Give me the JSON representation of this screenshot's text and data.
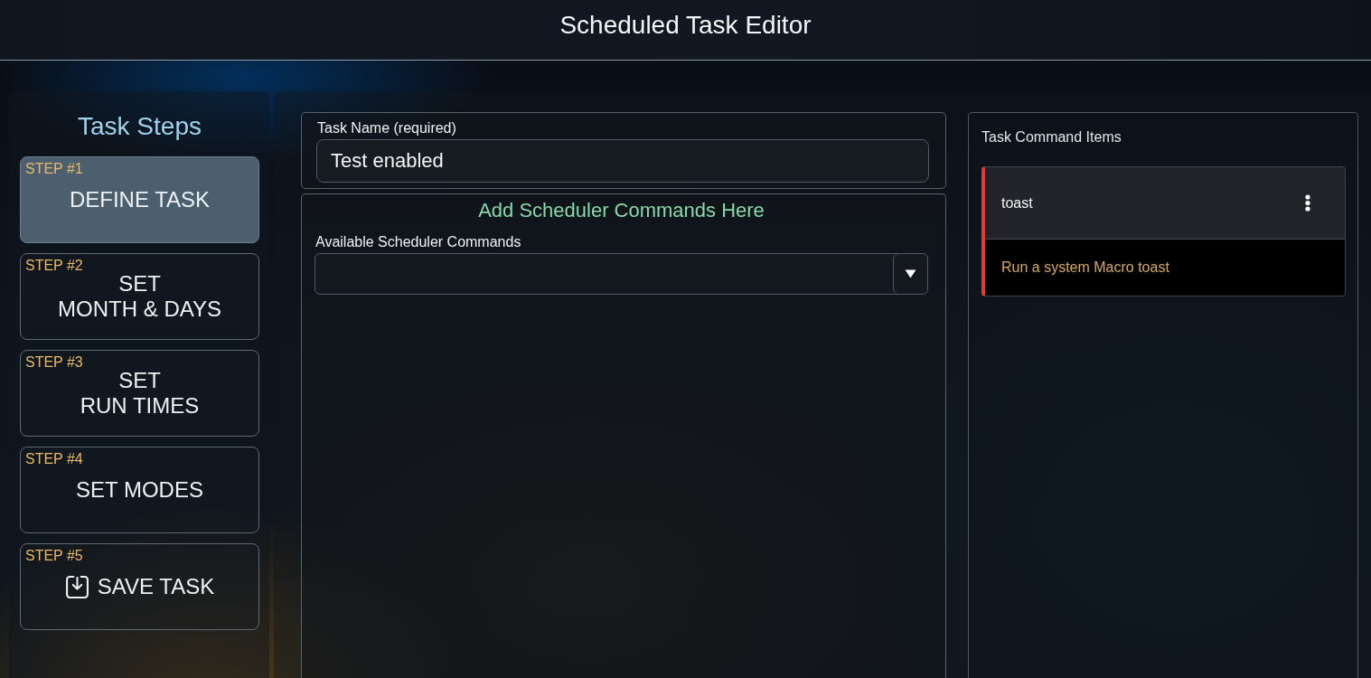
{
  "header": {
    "title": "Scheduled Task Editor"
  },
  "sidebar": {
    "title": "Task Steps",
    "steps": [
      {
        "kind": "step",
        "step_label": "STEP #1",
        "lines": [
          "DEFINE TASK"
        ],
        "selected": true
      },
      {
        "kind": "step",
        "step_label": "STEP #2",
        "lines": [
          "SET",
          "MONTH & DAYS"
        ],
        "selected": false
      },
      {
        "kind": "step",
        "step_label": "STEP #3",
        "lines": [
          "SET",
          "RUN TIMES"
        ],
        "selected": false
      },
      {
        "kind": "step",
        "step_label": "STEP #4",
        "lines": [
          "SET MODES"
        ],
        "selected": false
      },
      {
        "kind": "save",
        "step_label": "STEP #5",
        "lines": [
          "SAVE TASK"
        ],
        "selected": false
      }
    ]
  },
  "task_name": {
    "label": "Task Name (required)",
    "value": "Test enabled"
  },
  "commands": {
    "heading": "Add Scheduler Commands Here",
    "select": {
      "label": "Available Scheduler Commands"
    }
  },
  "command_items": {
    "title": "Task Command Items",
    "items": [
      {
        "name": "toast",
        "description": "Run a system Macro toast"
      }
    ]
  }
}
